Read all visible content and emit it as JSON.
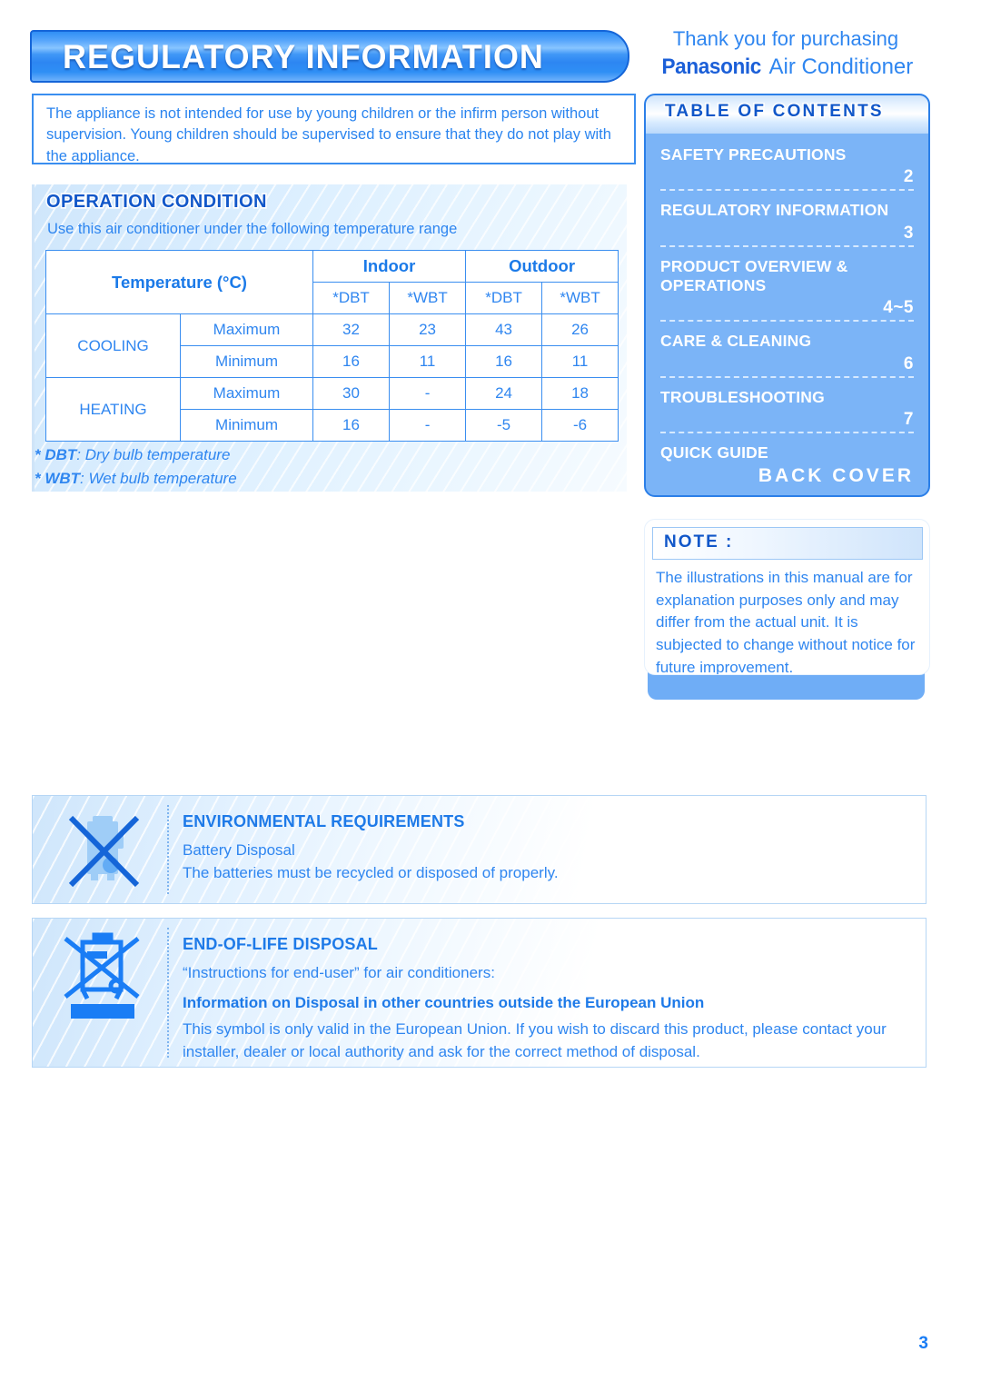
{
  "header": {
    "banner_title": "REGULATORY INFORMATION",
    "thanks_line1": "Thank you for purchasing",
    "brand": "Panasonic",
    "product": " Air Conditioner"
  },
  "warning": {
    "text": "The appliance is not intended for use by young children or the infirm person without supervision. Young children should be supervised to ensure that they do not play with the appliance."
  },
  "operation_condition": {
    "title": "OPERATION CONDITION",
    "subtitle": "Use this air conditioner under the following temperature range",
    "table": {
      "corner_header": "Temperature (°C)",
      "group_headers": [
        "Indoor",
        "Outdoor"
      ],
      "sub_headers": [
        "*DBT",
        "*WBT",
        "*DBT",
        "*WBT"
      ],
      "rows": [
        {
          "mode": "COOLING",
          "label": "Maximum",
          "values": [
            "32",
            "23",
            "43",
            "26"
          ]
        },
        {
          "mode": "COOLING",
          "label": "Minimum",
          "values": [
            "16",
            "11",
            "16",
            "11"
          ]
        },
        {
          "mode": "HEATING",
          "label": "Maximum",
          "values": [
            "30",
            "-",
            "24",
            "18"
          ]
        },
        {
          "mode": "HEATING",
          "label": "Minimum",
          "values": [
            "16",
            "-",
            "-5",
            "-6"
          ]
        }
      ]
    },
    "footnotes": [
      {
        "abbr": "* DBT",
        "sep": ":",
        "meaning": " Dry bulb temperature"
      },
      {
        "abbr": "* WBT",
        "sep": ":",
        "meaning": " Wet bulb temperature"
      }
    ]
  },
  "table_of_contents": {
    "title": "TABLE OF CONTENTS",
    "items": [
      {
        "label": "SAFETY PRECAUTIONS",
        "page": "2"
      },
      {
        "label": "REGULATORY INFORMATION",
        "page": "3"
      },
      {
        "label": "PRODUCT OVERVIEW & OPERATIONS",
        "page": "4~5"
      },
      {
        "label": "CARE & CLEANING",
        "page": "6"
      },
      {
        "label": "TROUBLESHOOTING",
        "page": "7"
      },
      {
        "label": "QUICK GUIDE",
        "page": "BACK COVER"
      }
    ]
  },
  "note": {
    "title": "NOTE :",
    "text": "The illustrations in this manual are for explanation purposes only and may differ from the actual unit. It is subjected to change without notice for future improvement."
  },
  "environmental": {
    "icon": "crossed-out-battery-bin-icon",
    "title": "ENVIRONMENTAL REQUIREMENTS",
    "line1": "Battery Disposal",
    "line2": "The batteries must be recycled or disposed of properly."
  },
  "end_of_life": {
    "icon": "weee-crossed-out-wheelie-bin-icon",
    "title": "END-OF-LIFE DISPOSAL",
    "line1": "“Instructions for end-user” for air conditioners:",
    "bold_line": "Information on Disposal in other countries outside the European Union",
    "body": "This symbol is only valid in the European Union. If you wish to discard this product, please contact your installer, dealer or local authority and ask for the correct method of disposal."
  },
  "footer": {
    "page_number": "3"
  },
  "colors": {
    "primary_blue": "#2f86f0",
    "deep_blue": "#1157c9",
    "panel_blue": "#7bb4f7",
    "border_blue": "#3a8ef0"
  }
}
